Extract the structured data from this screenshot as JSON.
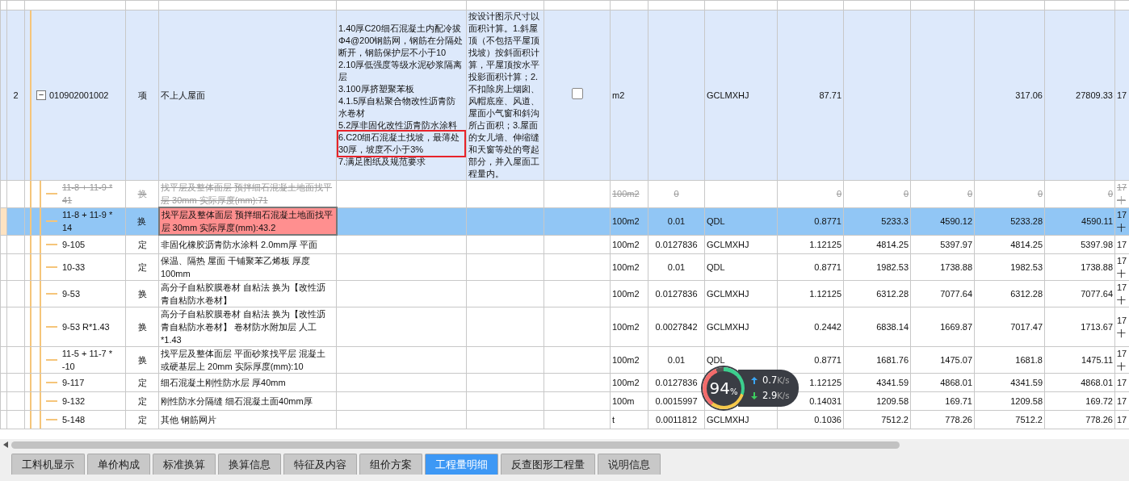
{
  "rows": [
    {
      "kind": "item",
      "number": "2",
      "code": "010902001002",
      "expanded": true,
      "toggle_symbol": "−",
      "category": "项",
      "name": "不上人屋面",
      "features": [
        {
          "text": "1.40厚C20细石混凝土内配冷拔Φ4@200钢筋网，钢筋在分隔处断开，钢筋保护层不小于10",
          "highlighted": false
        },
        {
          "text": "2.10厚低强度等级水泥砂浆隔离层",
          "highlighted": false
        },
        {
          "text": "3.100厚挤塑聚苯板",
          "highlighted": false
        },
        {
          "text": "4.1.5厚自粘聚合物改性沥青防水卷材",
          "highlighted": false
        },
        {
          "text": "5.2厚非固化改性沥青防水涂料",
          "highlighted": false
        },
        {
          "text": "6.C20细石混凝土找坡，最薄处30厚，坡度不小于3%",
          "highlighted": true
        },
        {
          "text": "7.满足图纸及规范要求",
          "highlighted": false
        }
      ],
      "rule": "按设计图示尺寸以面积计算。1.斜屋顶（不包括平屋顶找坡）按斜面积计算，平屋顶按水平投影面积计算；2.不扣除房上烟囱、风帽底座、风道、屋面小气窗和斜沟所占面积；3.屋面的女儿墙、伸缩缝和天窗等处的弯起部分，并入屋面工程量内。",
      "checked": false,
      "struck": false,
      "selected": false,
      "cells": [
        "m2",
        "",
        "GCLMXHJ",
        "87.71",
        "",
        "",
        "317.06",
        "27809.33"
      ],
      "last": [
        "17"
      ]
    },
    {
      "kind": "sub",
      "code": "11-8 + 11-9 * 41",
      "category": "换",
      "name": "找平层及整体面层 预拌细石混凝土地面找平层 30mm  实际厚度(mm):71",
      "struck": true,
      "selected": false,
      "cells": [
        "100m2",
        "0",
        "",
        "0",
        "0",
        "0",
        "0",
        "0"
      ],
      "last": [
        "17",
        "十"
      ]
    },
    {
      "kind": "sub",
      "code": "11-8 + 11-9 * 14",
      "category": "换",
      "name": "找平层及整体面层 预拌细石混凝土地面找平层 30mm  实际厚度(mm):43.2",
      "struck": false,
      "selected": true,
      "cells": [
        "100m2",
        "0.01",
        "QDL",
        "0.8771",
        "5233.3",
        "4590.12",
        "5233.28",
        "4590.11"
      ],
      "last": [
        "17",
        "十"
      ]
    },
    {
      "kind": "sub",
      "code": "9-105",
      "category": "定",
      "name": "非固化橡胶沥青防水涂料 2.0mm厚 平面",
      "struck": false,
      "selected": false,
      "cells": [
        "100m2",
        "0.0127836",
        "GCLMXHJ",
        "1.12125",
        "4814.25",
        "5397.97",
        "4814.25",
        "5397.98"
      ],
      "last": [
        "17"
      ]
    },
    {
      "kind": "sub",
      "code": "10-33",
      "category": "定",
      "name": "保温、隔热 屋面 干铺聚苯乙烯板 厚度100mm",
      "struck": false,
      "selected": false,
      "cells": [
        "100m2",
        "0.01",
        "QDL",
        "0.8771",
        "1982.53",
        "1738.88",
        "1982.53",
        "1738.88"
      ],
      "last": [
        "17",
        "十"
      ]
    },
    {
      "kind": "sub",
      "code": "9-53",
      "category": "换",
      "name": "高分子自粘胶膜卷材 自粘法  换为【改性沥青自粘防水卷材】",
      "struck": false,
      "selected": false,
      "cells": [
        "100m2",
        "0.0127836",
        "GCLMXHJ",
        "1.12125",
        "6312.28",
        "7077.64",
        "6312.28",
        "7077.64"
      ],
      "last": [
        "17",
        "十"
      ]
    },
    {
      "kind": "sub",
      "code": "9-53 R*1.43",
      "category": "换",
      "name": "高分子自粘胶膜卷材 自粘法  换为【改性沥青自粘防水卷材】  卷材防水附加层 人工*1.43",
      "struck": false,
      "selected": false,
      "cells": [
        "100m2",
        "0.0027842",
        "GCLMXHJ",
        "0.2442",
        "6838.14",
        "1669.87",
        "7017.47",
        "1713.67"
      ],
      "last": [
        "17",
        "十"
      ]
    },
    {
      "kind": "sub",
      "code": "11-5 + 11-7 * -10",
      "category": "换",
      "name": "找平层及整体面层 平面砂浆找平层 混凝土或硬基层上 20mm  实际厚度(mm):10",
      "struck": false,
      "selected": false,
      "cells": [
        "100m2",
        "0.01",
        "QDL",
        "0.8771",
        "1681.76",
        "1475.07",
        "1681.8",
        "1475.11"
      ],
      "last": [
        "17",
        "十"
      ]
    },
    {
      "kind": "sub",
      "code": "9-117",
      "category": "定",
      "name": "细石混凝土刚性防水层 厚40mm",
      "struck": false,
      "selected": false,
      "cells": [
        "100m2",
        "0.0127836",
        "",
        "1.12125",
        "4341.59",
        "4868.01",
        "4341.59",
        "4868.01"
      ],
      "last": [
        "17"
      ]
    },
    {
      "kind": "sub",
      "code": "9-132",
      "category": "定",
      "name": "刚性防水分隔缝 细石混凝土面40mm厚",
      "struck": false,
      "selected": false,
      "cells": [
        "100m",
        "0.0015997",
        "",
        "0.14031",
        "1209.58",
        "169.71",
        "1209.58",
        "169.72"
      ],
      "last": [
        "17"
      ]
    },
    {
      "kind": "sub",
      "code": "5-148",
      "category": "定",
      "name": "其他 钢筋网片",
      "struck": false,
      "selected": false,
      "cells": [
        "t",
        "0.0011812",
        "GCLMXHJ",
        "0.1036",
        "7512.2",
        "778.26",
        "7512.2",
        "778.26"
      ],
      "last": [
        "17"
      ]
    }
  ],
  "tabs": [
    {
      "label": "工料机显示",
      "selected": false
    },
    {
      "label": "单价构成",
      "selected": false
    },
    {
      "label": "标准换算",
      "selected": false
    },
    {
      "label": "换算信息",
      "selected": false
    },
    {
      "label": "特征及内容",
      "selected": false
    },
    {
      "label": "组价方案",
      "selected": false
    },
    {
      "label": "工程量明细",
      "selected": true
    },
    {
      "label": "反查图形工程量",
      "selected": false
    },
    {
      "label": "说明信息",
      "selected": false
    }
  ],
  "speed_widget": {
    "percent": "94",
    "percent_sign": "%",
    "upload": "0.7",
    "download": "2.9",
    "unit_up": "K/s",
    "unit_down": "K/s"
  }
}
